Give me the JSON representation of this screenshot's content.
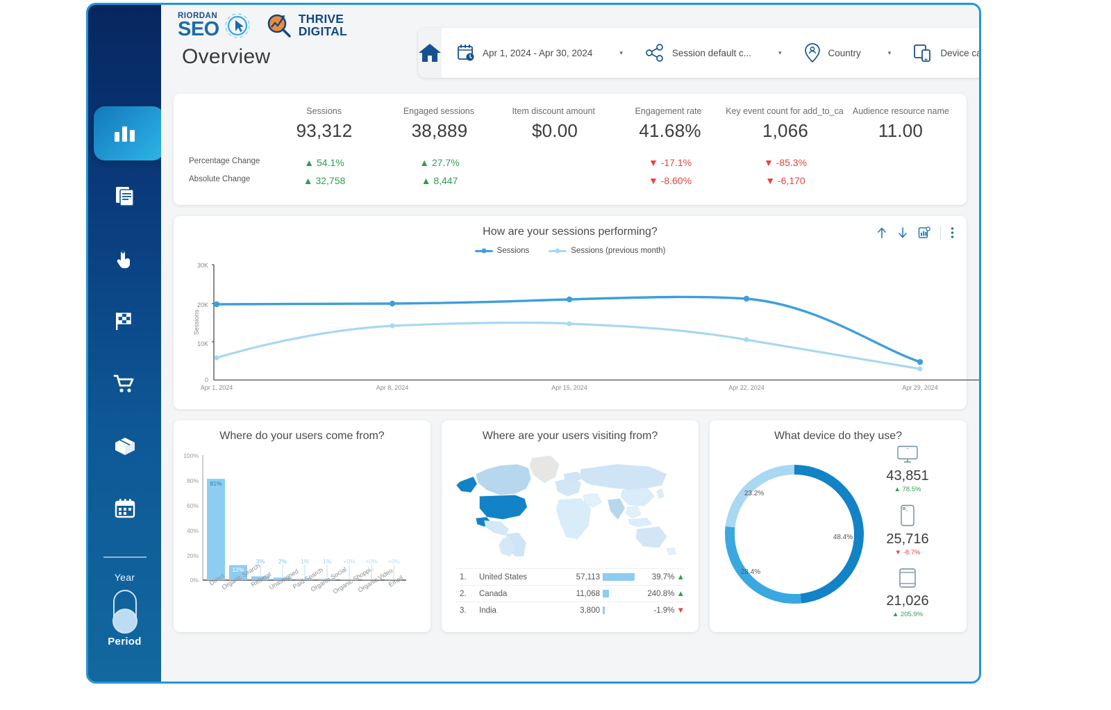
{
  "brand": {
    "riordan": "RIORDAN",
    "seo": "SEO",
    "thrive_line1": "THRIVE",
    "thrive_line2": "DIGITAL"
  },
  "header": {
    "page_title": "Overview"
  },
  "filters": [
    {
      "icon": "calendar-clock-icon",
      "label": "Apr 1, 2024 - Apr 30, 2024"
    },
    {
      "icon": "share-nodes-icon",
      "label": "Session default c..."
    },
    {
      "icon": "location-pin-person-icon",
      "label": "Country"
    },
    {
      "icon": "devices-icon",
      "label": "Device category"
    }
  ],
  "sidebar": {
    "items": [
      {
        "icon": "bar-chart-icon",
        "name": "sidebar-item-overview",
        "active": true
      },
      {
        "icon": "pages-document-icon",
        "name": "sidebar-item-pages",
        "active": false
      },
      {
        "icon": "tap-click-icon",
        "name": "sidebar-item-events",
        "active": false
      },
      {
        "icon": "checkered-flag-icon",
        "name": "sidebar-item-conversions",
        "active": false
      },
      {
        "icon": "shopping-cart-icon",
        "name": "sidebar-item-ecommerce",
        "active": false
      },
      {
        "icon": "package-box-icon",
        "name": "sidebar-item-products",
        "active": false
      },
      {
        "icon": "calendar-icon",
        "name": "sidebar-item-calendar",
        "active": false
      }
    ],
    "toggle_top_label": "Year",
    "toggle_bottom_label": "Period"
  },
  "kpi": {
    "row_labels": {
      "percentage": "Percentage Change",
      "absolute": "Absolute Change"
    },
    "metrics": [
      {
        "title": "Sessions",
        "value": "93,312",
        "pct": "54.1%",
        "pct_dir": "up",
        "abs": "32,758",
        "abs_dir": "up"
      },
      {
        "title": "Engaged sessions",
        "value": "38,889",
        "pct": "27.7%",
        "pct_dir": "up",
        "abs": "8,447",
        "abs_dir": "up"
      },
      {
        "title": "Item discount amount",
        "value": "$0.00",
        "pct": "",
        "pct_dir": "none",
        "abs": "",
        "abs_dir": "none"
      },
      {
        "title": "Engagement rate",
        "value": "41.68%",
        "pct": "-17.1%",
        "pct_dir": "down",
        "abs": "-8.60%",
        "abs_dir": "down"
      },
      {
        "title": "Key event count for add_to_ca",
        "value": "1,066",
        "pct": "-85.3%",
        "pct_dir": "down",
        "abs": "-6,170",
        "abs_dir": "down"
      },
      {
        "title": "Audience resource name",
        "value": "11.00",
        "pct": "",
        "pct_dir": "none",
        "abs": "",
        "abs_dir": "none"
      }
    ]
  },
  "sessions_panel": {
    "title": "How are your sessions performing?",
    "tools": [
      "arrow-up-icon",
      "arrow-down-icon",
      "chart-export-icon",
      "more-vertical-icon"
    ]
  },
  "panels": {
    "sources_title": "Where do your users come from?",
    "geo_title": "Where are your users visiting from?",
    "device_title": "What device do they use?"
  },
  "geo_rows": [
    {
      "rank": "1.",
      "country": "United States",
      "sessions": "57,113",
      "bar_pct": 100,
      "change": "39.7%",
      "dir": "up"
    },
    {
      "rank": "2.",
      "country": "Canada",
      "sessions": "11,068",
      "bar_pct": 19,
      "change": "240.8%",
      "dir": "up"
    },
    {
      "rank": "3.",
      "country": "India",
      "sessions": "3,800",
      "bar_pct": 6,
      "change": "-1.9%",
      "dir": "down"
    }
  ],
  "devices": [
    {
      "icon": "desktop-icon",
      "value": "43,851",
      "change": "78.5%",
      "dir": "up"
    },
    {
      "icon": "mobile-icon",
      "value": "25,716",
      "change": "-8.7%",
      "dir": "down"
    },
    {
      "icon": "tablet-icon",
      "value": "21,026",
      "change": "205.9%",
      "dir": "up"
    }
  ],
  "colors": {
    "primary_blue": "#2196d6",
    "dark_navy": "#07265f",
    "series_current": "#3d9fdb",
    "series_previous": "#a8d8f2",
    "bar_blue": "#8ecdf2",
    "donut_dark": "#1183c6",
    "donut_mid": "#3aa8e0",
    "donut_light": "#a8d8f2",
    "positive": "#2e9e52",
    "negative": "#e8453c"
  },
  "chart_data": [
    {
      "type": "line",
      "title": "How are your sessions performing?",
      "xlabel": "",
      "ylabel": "Sessions",
      "ylim": [
        0,
        30000
      ],
      "yticks": [
        "0",
        "10K",
        "20K",
        "30K"
      ],
      "ytick_values": [
        0,
        10000,
        20000,
        30000
      ],
      "xticks": [
        "Apr 1, 2024",
        "Apr 8, 2024",
        "Apr 15, 2024",
        "Apr 22, 2024",
        "Apr 29, 2024"
      ],
      "grid": false,
      "legend": "top-center",
      "series": [
        {
          "name": "Sessions",
          "color": "#3d9fdb",
          "values": [
            19700,
            19800,
            20500,
            20600,
            8100
          ]
        },
        {
          "name": "Sessions (previous month)",
          "color": "#a8d8f2",
          "values": [
            5800,
            17700,
            17300,
            14000,
            6600
          ]
        }
      ]
    },
    {
      "type": "bar",
      "title": "Where do your users come from?",
      "xlabel": "",
      "ylabel": "",
      "ylim": [
        0,
        100
      ],
      "yticks": [
        "0%",
        "20%",
        "40%",
        "60%",
        "80%",
        "100%"
      ],
      "categories": [
        "Direct",
        "Organic Search",
        "Referral",
        "Unassigned",
        "Paid Search",
        "Organic Social",
        "Organic Shoppi..",
        "Organic Video",
        "Email"
      ],
      "values": [
        81,
        12,
        3,
        2,
        1,
        1,
        0,
        0,
        0
      ],
      "value_labels": [
        "81%",
        "12%",
        "3%",
        "2%",
        "1%",
        "1%",
        "+0%",
        "+0%",
        "+0%"
      ],
      "grid": false
    },
    {
      "type": "pie",
      "title": "What device do they use?",
      "labels": [
        "48.4%",
        "28.4%",
        "23.2%"
      ],
      "values": [
        48.4,
        28.4,
        23.2
      ],
      "colors": [
        "#1183c6",
        "#3aa8e0",
        "#a8d8f2"
      ],
      "donut": true,
      "legend": "none"
    }
  ]
}
